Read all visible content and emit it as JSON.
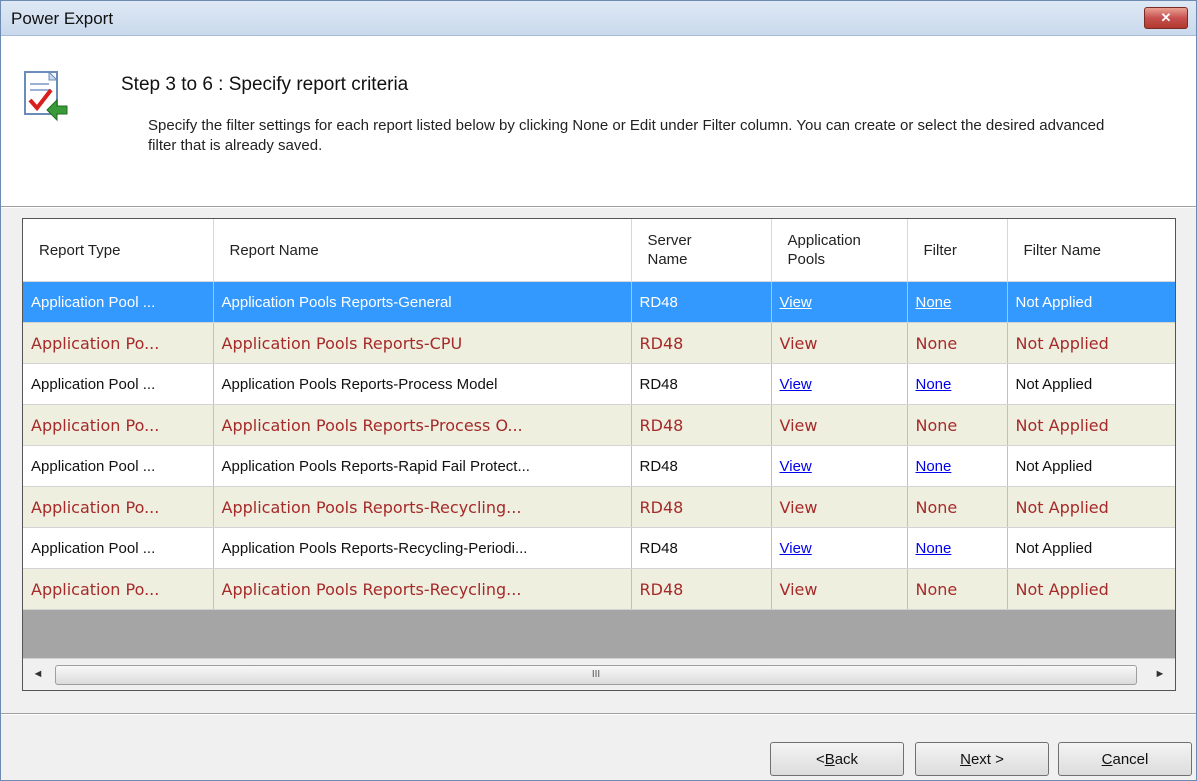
{
  "window": {
    "title": "Power Export",
    "close_glyph": "✕"
  },
  "header": {
    "icon": "report-check-icon",
    "step_title": "Step 3 to 6 : Specify report criteria",
    "description": "Specify the filter settings for each report listed below by clicking None or Edit under Filter column. You can create or select the desired advanced filter that is already saved."
  },
  "grid": {
    "columns": [
      {
        "label": "Report Type"
      },
      {
        "label": "Report Name"
      },
      {
        "label": "Server Name"
      },
      {
        "label": "Application Pools"
      },
      {
        "label": "Filter"
      },
      {
        "label": "Filter Name"
      }
    ],
    "rows": [
      {
        "type": "Application Pool ...",
        "name": "Application Pools Reports-General",
        "server": "RD48",
        "pools": "View",
        "filter": "None",
        "filter_name": "Not Applied"
      },
      {
        "type": "Application Po...",
        "name": "Application Pools Reports-CPU",
        "server": "RD48",
        "pools": "View",
        "filter": "None",
        "filter_name": "Not Applied"
      },
      {
        "type": "Application Pool ...",
        "name": "Application Pools Reports-Process Model",
        "server": "RD48",
        "pools": "View",
        "filter": "None",
        "filter_name": "Not Applied"
      },
      {
        "type": "Application Po...",
        "name": "Application Pools Reports-Process O...",
        "server": "RD48",
        "pools": "View",
        "filter": "None",
        "filter_name": "Not Applied"
      },
      {
        "type": "Application Pool ...",
        "name": "Application Pools Reports-Rapid Fail Protect...",
        "server": "RD48",
        "pools": "View",
        "filter": "None",
        "filter_name": "Not Applied"
      },
      {
        "type": "Application Po...",
        "name": "Application Pools Reports-Recycling...",
        "server": "RD48",
        "pools": "View",
        "filter": "None",
        "filter_name": "Not Applied"
      },
      {
        "type": "Application Pool ...",
        "name": "Application Pools Reports-Recycling-Periodi...",
        "server": "RD48",
        "pools": "View",
        "filter": "None",
        "filter_name": "Not Applied"
      },
      {
        "type": "Application Po...",
        "name": "Application Pools Reports-Recycling...",
        "server": "RD48",
        "pools": "View",
        "filter": "None",
        "filter_name": "Not Applied"
      }
    ],
    "scroll": {
      "left": "◄",
      "right": "►",
      "grip": "III"
    },
    "colors": {
      "selected": "#3399ff",
      "alt_row": "#efefdf",
      "alt_text": "#a52a2a"
    }
  },
  "buttons": {
    "back_mnemonic": "B",
    "back_pre": "<",
    "back_rest": "ack",
    "next_mnemonic": "N",
    "next_rest": "ext >",
    "cancel_mnemonic": "C",
    "cancel_rest": "ancel"
  }
}
